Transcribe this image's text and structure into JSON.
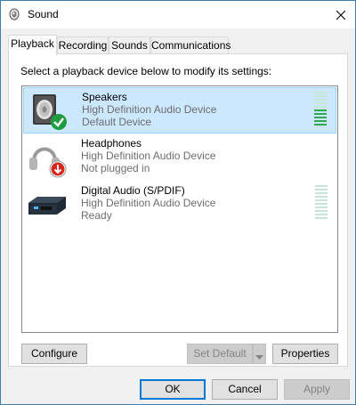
{
  "window": {
    "title": "Sound"
  },
  "tabs": [
    {
      "label": "Playback",
      "active": true
    },
    {
      "label": "Recording",
      "active": false
    },
    {
      "label": "Sounds",
      "active": false
    },
    {
      "label": "Communications",
      "active": false
    }
  ],
  "playback": {
    "instruction": "Select a playback device below to modify its settings:",
    "devices": [
      {
        "name": "Speakers",
        "description": "High Definition Audio Device",
        "status": "Default Device",
        "icon": "speaker-icon",
        "badge": "green-check-icon",
        "selected": true,
        "level_fraction": 0.45
      },
      {
        "name": "Headphones",
        "description": "High Definition Audio Device",
        "status": "Not plugged in",
        "icon": "headphones-icon",
        "badge": "red-down-arrow-icon",
        "selected": false
      },
      {
        "name": "Digital Audio (S/PDIF)",
        "description": "High Definition Audio Device",
        "status": "Ready",
        "icon": "digital-audio-device-icon",
        "selected": false,
        "level_fraction": 0
      }
    ],
    "configure_label": "Configure",
    "set_default_label": "Set Default",
    "properties_label": "Properties"
  },
  "footer": {
    "ok_label": "OK",
    "cancel_label": "Cancel",
    "apply_label": "Apply"
  },
  "colors": {
    "selection": "#cce8ff",
    "selection_border": "#99d1ff",
    "level_on": "#2fa84f",
    "level_off": "#c6e6d4",
    "accent": "#0078d7"
  }
}
